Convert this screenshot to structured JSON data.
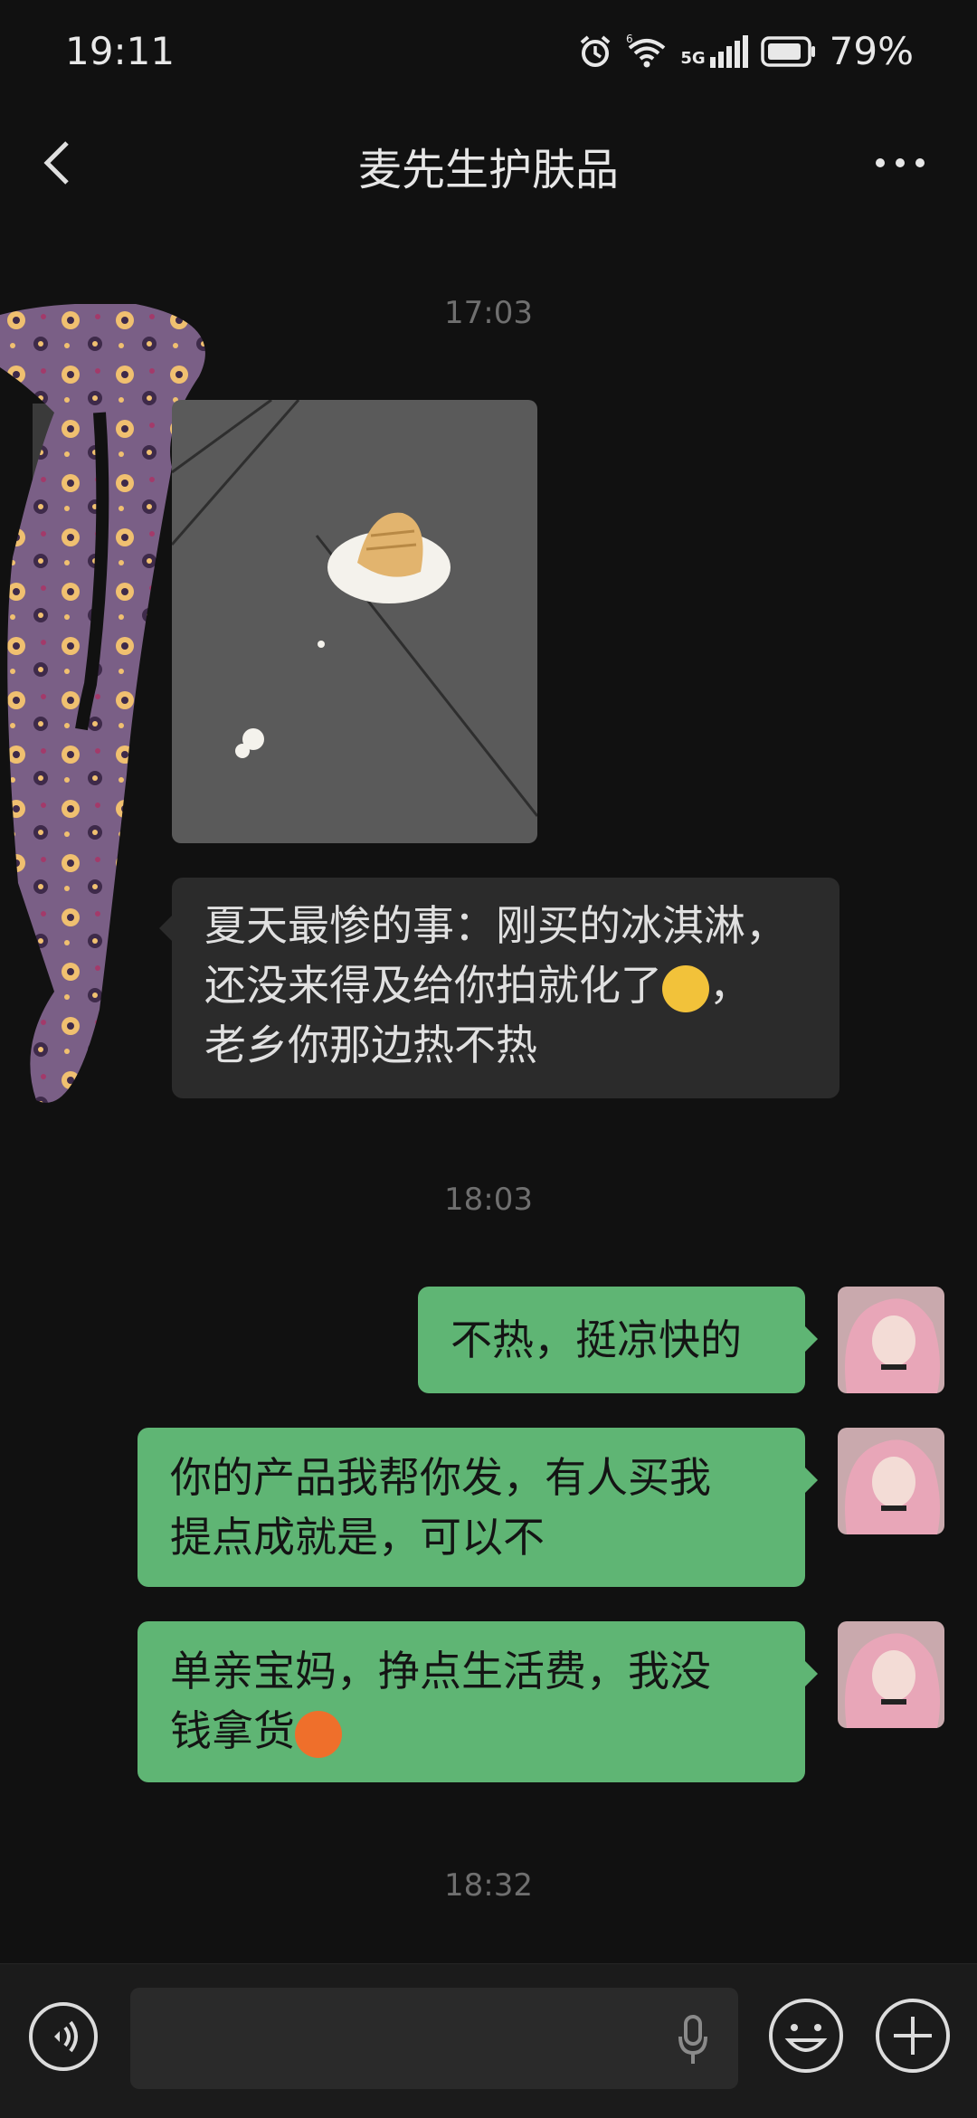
{
  "status": {
    "time": "19:11",
    "battery": "79%",
    "network": "5G",
    "wifi_tag": "6"
  },
  "header": {
    "title": "麦先生护肤品"
  },
  "messages": {
    "ts1": "17:03",
    "msg_in_lines": [
      "夏天最惨的事：刚买的冰淇淋，",
      "还没来得及给你拍就化了",
      "，",
      "老乡你那边热不热"
    ],
    "ts2": "18:03",
    "out1": "不热，挺凉快的",
    "out2_lines": [
      "你的产品我帮你发，有人买我",
      "提点成就是，可以不"
    ],
    "out3_lines": [
      "单亲宝妈，挣点生活费，我没",
      "钱拿货"
    ],
    "ts3": "18:32"
  },
  "icons": {
    "back": "chevron-left-icon",
    "more": "more-icon",
    "voice": "voice-icon",
    "mic": "mic-icon",
    "emoji": "emoji-icon",
    "plus": "plus-icon"
  },
  "colors": {
    "outgoing": "#5fb574",
    "incoming": "#2b2b2b",
    "background": "#111111"
  }
}
